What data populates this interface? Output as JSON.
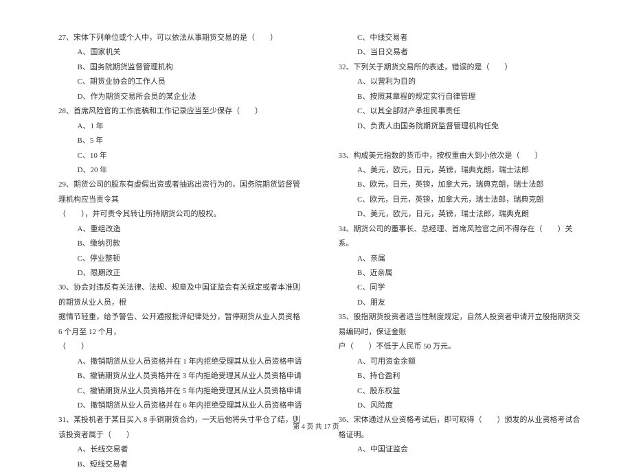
{
  "left": {
    "q27": {
      "title": "27、宋体下列单位或个人中，可以依法从事期货交易的是（　　）",
      "a": "A、国家机关",
      "b": "B、国务院期货监督管理机构",
      "c": "C、期货业协会的工作人员",
      "d": "D、作为期货交易所会员的某企业法"
    },
    "q28": {
      "title": "28、首席风险官的工作底稿和工作记录应当至少保存（　　）",
      "a": "A、1 年",
      "b": "B、5 年",
      "c": "C、10 年",
      "d": "D、20 年"
    },
    "q29": {
      "title": "29、期货公司的股东有虚假出资或者抽逃出资行为的，国务院期货监督管理机构应当责令其",
      "cont": "（　　），并可责令其转让所持期货公司的股权。",
      "a": "A、重组改造",
      "b": "B、缴纳罚款",
      "c": "C、停业整顿",
      "d": "D、限期改正"
    },
    "q30": {
      "title": "30、协会对违反有关法律、法规、规章及中国证监会有关规定或者本准则的期货从业人员，根",
      "cont": "据情节轻重，给予警告、公开通报批评纪律处分，暂停期货从业人员资格 6 个月至 12 个月，",
      "cont2": "（　　）",
      "a": "A、撤销期货从业人员资格并在 1 年内拒绝受理其从业人员资格申请",
      "b": "B、撤销期货从业人员资格并在 3 年内拒绝受理其从业人员资格申请",
      "c": "C、撤销期货从业人员资格并在 5 年内拒绝受理其从业人员资格申请",
      "d": "D、撤销期货从业人员资格并在 6 年内拒绝受理其从业人员资格申请"
    },
    "q31": {
      "title": "31、某投机者于某日买入 8 手铜期货合约，一天后他将头寸平仓了结，则该投资者属于（　　）",
      "a": "A、长线交易者",
      "b": "B、短线交易者"
    }
  },
  "right": {
    "q31r": {
      "c": "C、中线交易者",
      "d": "D、当日交易者"
    },
    "q32": {
      "title": "32、下列关于期货交易所的表述，错误的是（　　）",
      "a": "A、以营利为目的",
      "b": "B、按照其章程的规定实行自律管理",
      "c": "C、以其全部财产承担民事责任",
      "d": "D、负责人由国务院期货监督管理机构任免"
    },
    "q33": {
      "title": "33、构成美元指数的货币中，按权重由大到小依次是（　　）",
      "a": "A、美元，欧元，日元，英镑，瑞典克朗，瑞士法郎",
      "b": "B、欧元，日元，英镑，加拿大元，瑞典克朗，瑞士法郎",
      "c": "C、欧元，日元，英镑，加拿大元，瑞士法郎，瑞典克朗",
      "d": "D、美元，欧元，日元，英镑，瑞士法郎，瑞典克朗"
    },
    "q34": {
      "title": "34、期货公司的董事长、总经理、首席风险官之间不得存在（　　）关系。",
      "a": "A、亲属",
      "b": "B、近亲属",
      "c": "C、同学",
      "d": "D、朋友"
    },
    "q35": {
      "title": "35、股指期货投资者适当性制度规定，自然人投资者申请开立股指期货交易编码时，保证金账",
      "cont": "户（　　）不低于人民币 50 万元。",
      "a": "A、可用资金余额",
      "b": "B、持仓盈利",
      "c": "C、股东权益",
      "d": "D、风险度"
    },
    "q36": {
      "title": "36、宋体通过从业资格考试后，即可取得（　　）颁发的从业资格考试合格证明。",
      "a": "A、中国证监会"
    }
  },
  "footer": "第 4 页 共 17 页"
}
